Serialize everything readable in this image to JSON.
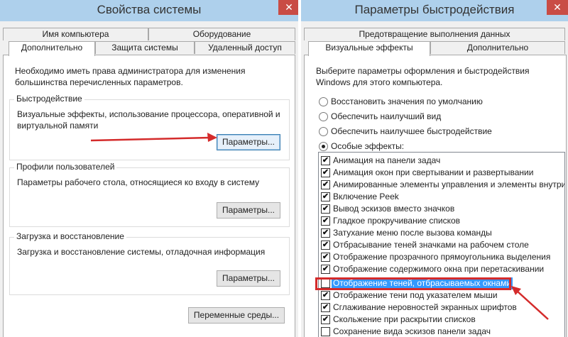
{
  "left_window": {
    "title": "Свойства системы",
    "close": "✕",
    "tabs_row1": [
      "Имя компьютера",
      "Оборудование"
    ],
    "tabs_row2": [
      "Дополнительно",
      "Защита системы",
      "Удаленный доступ"
    ],
    "active_tab": "Дополнительно",
    "admin_note": "Необходимо иметь права администратора для изменения большинства перечисленных параметров.",
    "performance": {
      "label": "Быстродействие",
      "desc": "Визуальные эффекты, использование процессора, оперативной и виртуальной памяти",
      "button": "Параметры..."
    },
    "profiles": {
      "label": "Профили пользователей",
      "desc": "Параметры рабочего стола, относящиеся ко входу в систему",
      "button": "Параметры..."
    },
    "startup": {
      "label": "Загрузка и восстановление",
      "desc": "Загрузка и восстановление системы, отладочная информация",
      "button": "Параметры..."
    },
    "env_button": "Переменные среды..."
  },
  "right_window": {
    "title": "Параметры быстродействия",
    "close": "✕",
    "tabs_row1": [
      "Предотвращение выполнения данных"
    ],
    "tabs_row2": [
      "Визуальные эффекты",
      "Дополнительно"
    ],
    "active_tab": "Визуальные эффекты",
    "intro": "Выберите параметры оформления и быстродействия Windows для этого компьютера.",
    "radios": [
      {
        "label": "Восстановить значения по умолчанию",
        "checked": false
      },
      {
        "label": "Обеспечить наилучший вид",
        "checked": false
      },
      {
        "label": "Обеспечить наилучшее быстродействие",
        "checked": false
      },
      {
        "label": "Особые эффекты:",
        "checked": true
      }
    ],
    "effects": [
      {
        "label": "Анимация на панели задач",
        "checked": true
      },
      {
        "label": "Анимация окон при свертывании и развертывании",
        "checked": true
      },
      {
        "label": "Анимированные элементы управления и элементы внутри",
        "checked": true
      },
      {
        "label": "Включение Peek",
        "checked": true
      },
      {
        "label": "Вывод эскизов вместо значков",
        "checked": true
      },
      {
        "label": "Гладкое прокручивание списков",
        "checked": true
      },
      {
        "label": "Затухание меню после вызова команды",
        "checked": true
      },
      {
        "label": "Отбрасывание теней значками на рабочем столе",
        "checked": true
      },
      {
        "label": "Отображение прозрачного прямоугольника выделения",
        "checked": true
      },
      {
        "label": "Отображение содержимого окна при перетаскивании",
        "checked": true
      },
      {
        "label": "Отображение теней, отбрасываемых окнами",
        "checked": false,
        "selected": true
      },
      {
        "label": "Отображение тени под указателем мыши",
        "checked": true
      },
      {
        "label": "Сглаживание неровностей экранных шрифтов",
        "checked": true
      },
      {
        "label": "Скольжение при раскрытии списков",
        "checked": true
      },
      {
        "label": "Сохранение вида эскизов панели задач",
        "checked": false
      }
    ],
    "check_glyph": "✔"
  },
  "colors": {
    "titlebar": "#aed0ec",
    "close": "#c94c45",
    "selection": "#3399ff",
    "annotation_red": "#d42b2b"
  }
}
